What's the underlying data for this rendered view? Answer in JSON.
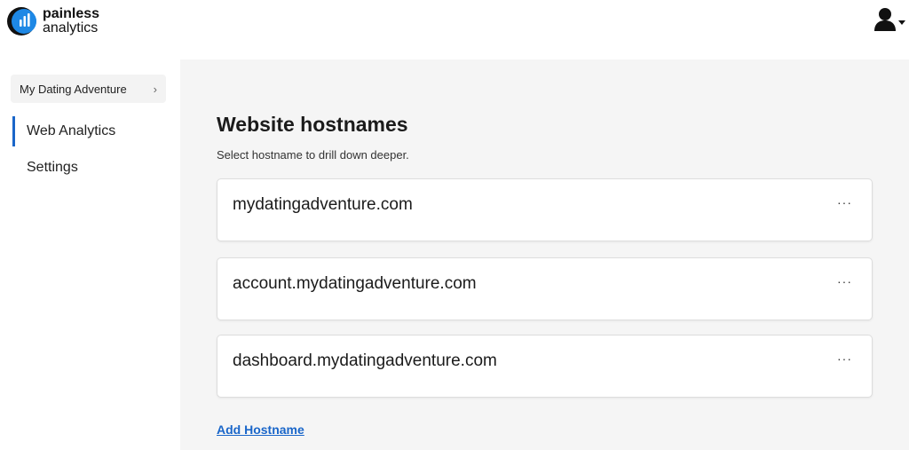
{
  "brand": {
    "name_line1": "painless",
    "name_line2": "analytics"
  },
  "header": {
    "user_icon": "user-icon",
    "dropdown_icon": "caret-down-icon"
  },
  "sidebar": {
    "project": {
      "label": "My Dating Adventure",
      "chevron": "›"
    },
    "items": [
      {
        "label": "Web Analytics",
        "active": true
      },
      {
        "label": "Settings",
        "active": false
      }
    ]
  },
  "main": {
    "title": "Website hostnames",
    "subtitle": "Select hostname to drill down deeper.",
    "hostnames": [
      {
        "name": "mydatingadventure.com",
        "menu": "···"
      },
      {
        "name": "account.mydatingadventure.com",
        "menu": "···"
      },
      {
        "name": "dashboard.mydatingadventure.com",
        "menu": "···"
      }
    ],
    "add_label": "Add Hostname"
  },
  "colors": {
    "accent": "#1a66c9",
    "main_bg": "#f5f5f5",
    "card_border": "#dddddd"
  }
}
